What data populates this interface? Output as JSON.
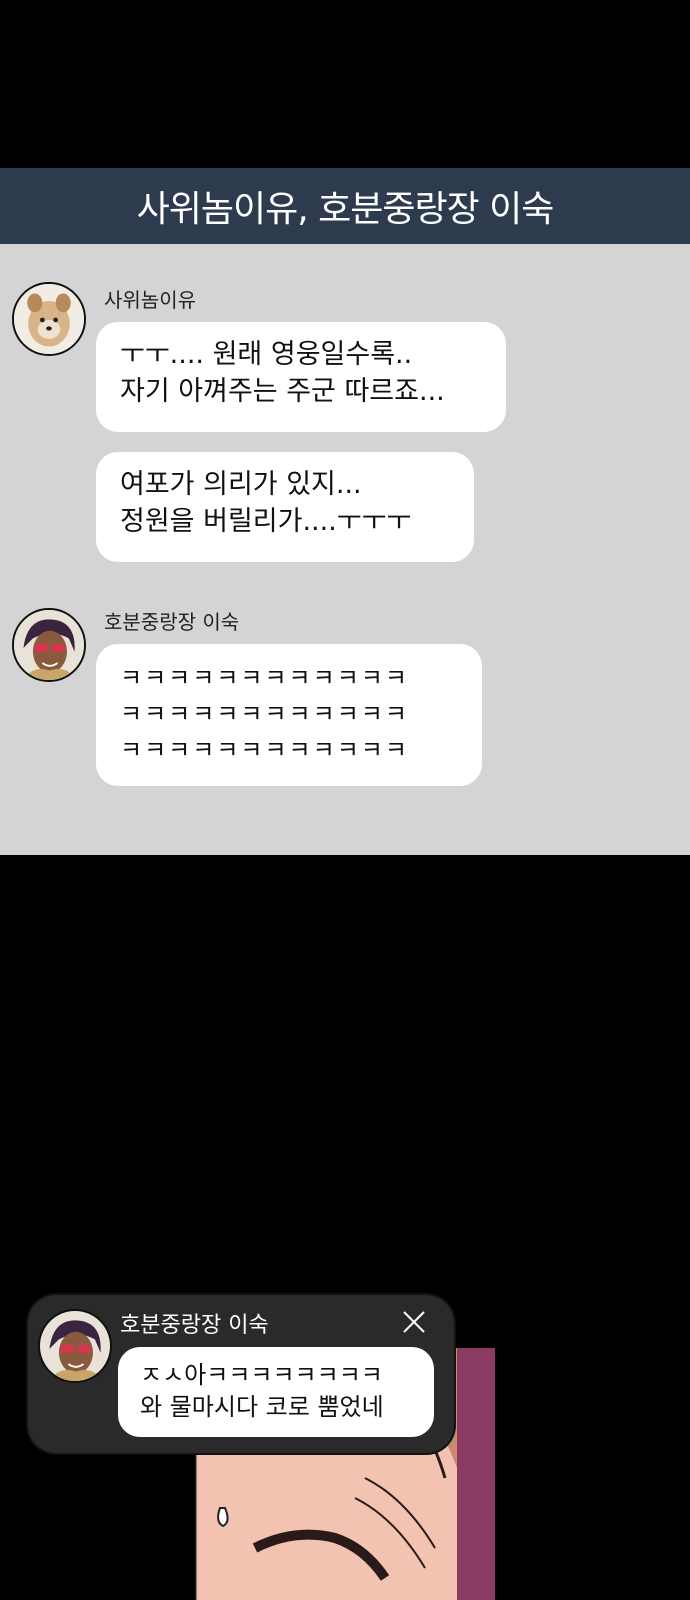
{
  "chat": {
    "title": "사위놈이유, 호분중랑장 이숙",
    "groups": [
      {
        "sender": "사위놈이유",
        "avatar_icon": "dog-avatar-icon",
        "messages": [
          "ㅜㅜ.... 원래 영웅일수록..\n자기 아껴주는 주군 따르죠...",
          "여포가 의리가 있지...\n정원을 버릴리가....ㅜㅜㅜ"
        ]
      },
      {
        "sender": "호분중랑장 이숙",
        "avatar_icon": "sunglasses-man-avatar-icon",
        "messages": [
          "ㅋㅋㅋㅋㅋㅋㅋㅋㅋㅋㅋㅋ\nㅋㅋㅋㅋㅋㅋㅋㅋㅋㅋㅋㅋ\nㅋㅋㅋㅋㅋㅋㅋㅋㅋㅋㅋㅋ"
        ]
      }
    ]
  },
  "notification": {
    "sender": "호분중랑장 이숙",
    "message": "ㅈㅅ아ㅋㅋㅋㅋㅋㅋㅋㅋ\n와 물마시다 코로 뿜었네",
    "close_icon": "close-icon"
  },
  "colors": {
    "header_bg": "#2e3b4f",
    "chat_bg": "#d4d4d4",
    "bubble_bg": "#ffffff",
    "notif_bg": "#2a2a2a"
  }
}
